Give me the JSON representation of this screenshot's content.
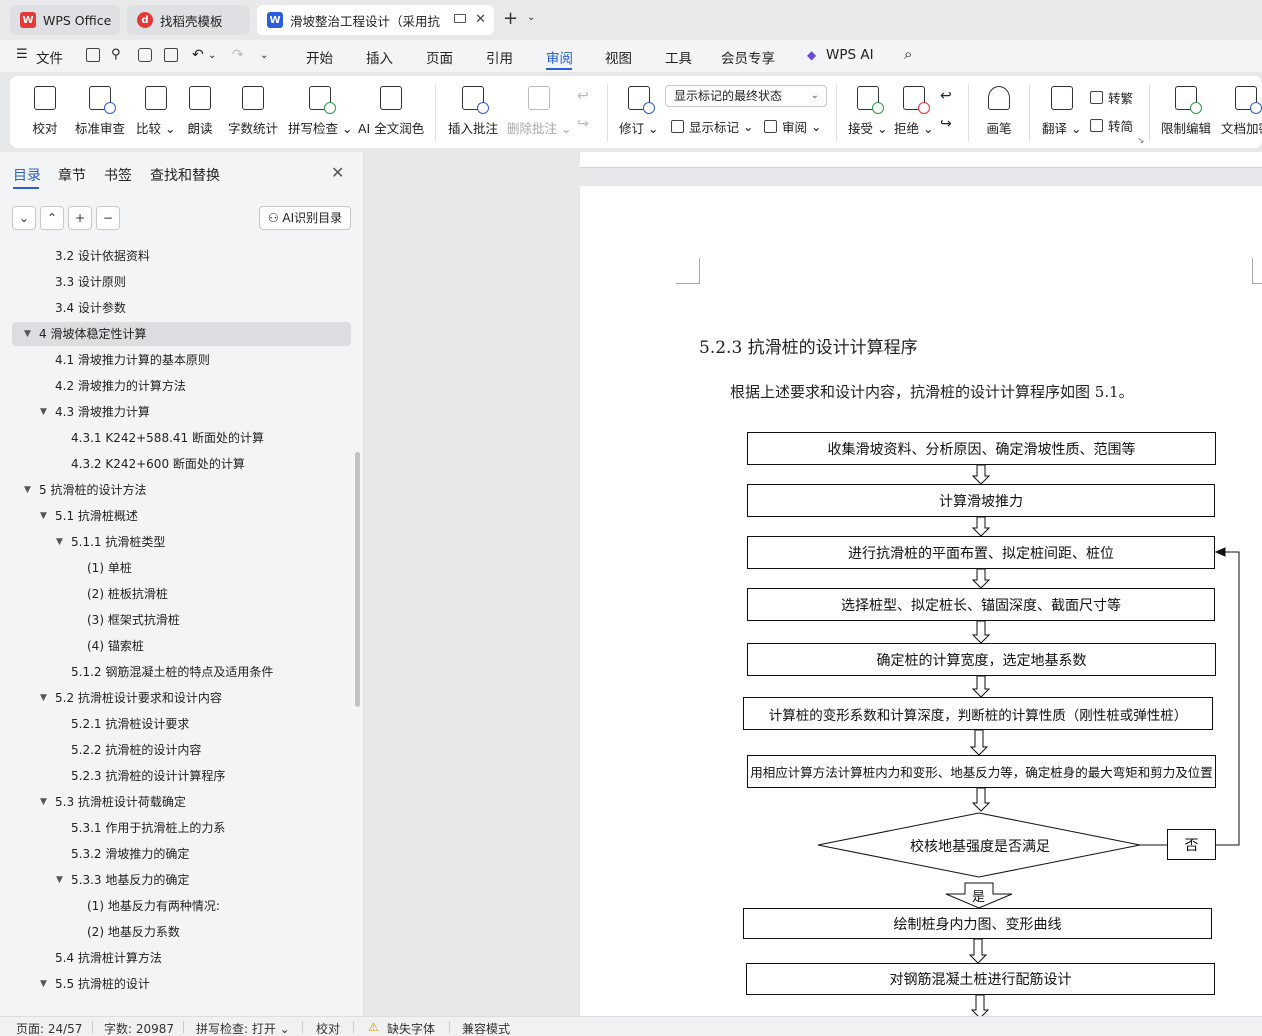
{
  "tabs": [
    {
      "label": "WPS Office",
      "icon": "wps-logo-icon"
    },
    {
      "label": "找稻壳模板",
      "icon": "docer-icon"
    },
    {
      "label": "滑坡整治工程设计（采用抗滑",
      "icon": "word-doc-icon"
    }
  ],
  "menu": {
    "file": "文件",
    "items": [
      "开始",
      "插入",
      "页面",
      "引用",
      "审阅",
      "视图",
      "工具",
      "会员专享",
      "WPS AI"
    ],
    "active": "审阅"
  },
  "ribbon": {
    "proofread": "校对",
    "standard_review": "标准审查",
    "compare": "比较",
    "read_aloud": "朗读",
    "word_count": "字数统计",
    "spell_check": "拼写检查",
    "ai_polish": "AI 全文润色",
    "insert_comment": "插入批注",
    "delete_comment": "删除批注",
    "revise": "修订",
    "display_status": "显示标记的最终状态",
    "show_markup": "显示标记",
    "review_pane": "审阅",
    "accept": "接受",
    "reject": "拒绝",
    "pen": "画笔",
    "translate": "翻译",
    "to_traditional": "转繁",
    "to_simplified": "转简",
    "restrict_edit": "限制编辑",
    "doc_encrypt": "文档加密"
  },
  "nav": {
    "tabs": [
      "目录",
      "章节",
      "书签",
      "查找和替换"
    ],
    "ai_toc": "AI识别目录",
    "toc": [
      {
        "t": "3.2  设计依据资料",
        "lvl": 2
      },
      {
        "t": "3.3 设计原则",
        "lvl": 2
      },
      {
        "t": "3.4 设计参数",
        "lvl": 2
      },
      {
        "t": "4      滑坡体稳定性计算",
        "lvl": 1,
        "exp": true,
        "sel": true
      },
      {
        "t": "4.1  滑坡推力计算的基本原则",
        "lvl": 2
      },
      {
        "t": "4.2  滑坡推力的计算方法",
        "lvl": 2
      },
      {
        "t": "4.3  滑坡推力计算",
        "lvl": 2,
        "exp": true
      },
      {
        "t": "4.3.1 K242+588.41 断面处的计算",
        "lvl": 3
      },
      {
        "t": "4.3.2 K242+600 断面处的计算",
        "lvl": 3
      },
      {
        "t": "5      抗滑桩的设计方法",
        "lvl": 1,
        "exp": true
      },
      {
        "t": "5.1  抗滑桩概述",
        "lvl": 2,
        "exp": true
      },
      {
        "t": "5.1.1  抗滑桩类型",
        "lvl": 3,
        "exp": true
      },
      {
        "t": "(1)  单桩",
        "lvl": 4
      },
      {
        "t": "(2)  桩板抗滑桩",
        "lvl": 4
      },
      {
        "t": "(3)  框架式抗滑桩",
        "lvl": 4
      },
      {
        "t": "(4)  锚索桩",
        "lvl": 4
      },
      {
        "t": "5.1.2  钢筋混凝土桩的特点及适用条件",
        "lvl": 3
      },
      {
        "t": "5.2  抗滑桩设计要求和设计内容",
        "lvl": 2,
        "exp": true
      },
      {
        "t": "5.2.1  抗滑桩设计要求",
        "lvl": 3
      },
      {
        "t": "5.2.2  抗滑桩的设计内容",
        "lvl": 3
      },
      {
        "t": "5.2.3  抗滑桩的设计计算程序",
        "lvl": 3
      },
      {
        "t": "5.3  抗滑桩设计荷载确定",
        "lvl": 2,
        "exp": true
      },
      {
        "t": "5.3.1  作用于抗滑桩上的力系",
        "lvl": 3
      },
      {
        "t": "5.3.2  滑坡推力的确定",
        "lvl": 3
      },
      {
        "t": "5.3.3  地基反力的确定",
        "lvl": 3,
        "exp": true
      },
      {
        "t": "(1)  地基反力有两种情况:",
        "lvl": 4
      },
      {
        "t": "(2)  地基反力系数",
        "lvl": 4
      },
      {
        "t": "5.4  抗滑桩计算方法",
        "lvl": 2
      },
      {
        "t": "5.5  抗滑桩的设计",
        "lvl": 2,
        "exp": true
      }
    ]
  },
  "doc": {
    "heading": "5.2.3  抗滑桩的设计计算程序",
    "paragraph": "根据上述要求和设计内容，抗滑桩的设计计算程序如图 5.1。",
    "flow": {
      "s1": "收集滑坡资料、分析原因、确定滑坡性质、范围等",
      "s2": "计算滑坡推力",
      "s3": "进行抗滑桩的平面布置、拟定桩间距、桩位",
      "s4": "选择桩型、拟定桩长、锚固深度、截面尺寸等",
      "s5": "确定桩的计算宽度，选定地基系数",
      "s6": "计算桩的变形系数和计算深度，判断桩的计算性质（刚性桩或弹性桩）",
      "s7": "用相应计算方法计算桩内力和变形、地基反力等，确定桩身的最大弯矩和剪力及位置",
      "decision": "校核地基强度是否满足",
      "no": "否",
      "yes": "是",
      "s8": "绘制桩身内力图、变形曲线",
      "s9": "对钢筋混凝土桩进行配筋设计"
    }
  },
  "status": {
    "page": "页面: 24/57",
    "words": "字数: 20987",
    "spell": "拼写检查: 打开",
    "proof": "校对",
    "missing_font": "缺失字体",
    "compat": "兼容模式"
  },
  "colors": {
    "accent": "#2b5fd9",
    "wps_red": "#e53935",
    "word_blue": "#2b5fd9"
  }
}
